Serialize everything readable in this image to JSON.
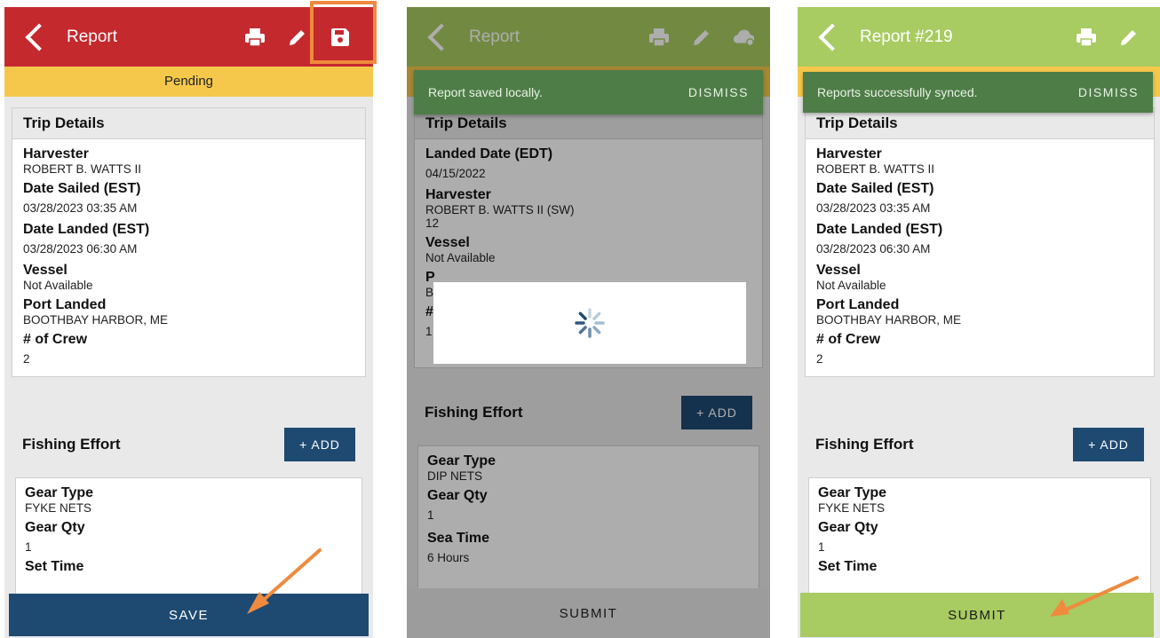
{
  "colors": {
    "saved_header": "#c4292e",
    "synced_header": "#a8cb62",
    "save_button": "#1e4a72",
    "submit_button_light": "#a8cb62",
    "submit_button_grey": "#e6e6e6",
    "pending_bar": "#f5c84c",
    "toast": "#4e7d47",
    "annotation": "#f08a3e"
  },
  "screen1": {
    "header": {
      "title": "Report",
      "icons": [
        "chevron-left-icon",
        "print-icon",
        "pencil-icon",
        "floppy-disk-icon"
      ]
    },
    "status": "Pending",
    "trip": {
      "title": "Trip Details",
      "fields": [
        {
          "label": "Harvester",
          "value": "ROBERT B. WATTS II"
        },
        {
          "label": "Date Sailed (EST)",
          "value": "03/28/2023 03:35 AM"
        },
        {
          "label": "Date Landed (EST)",
          "value": "03/28/2023 06:30 AM"
        },
        {
          "label": "Vessel",
          "value": "Not Available"
        },
        {
          "label": "Port Landed",
          "value": "BOOTHBAY HARBOR, ME"
        },
        {
          "label": "# of Crew",
          "value": "2"
        }
      ]
    },
    "effort": {
      "title": "Fishing Effort",
      "add_label": "+ ADD",
      "fields": [
        {
          "label": "Gear Type",
          "value": "FYKE NETS"
        },
        {
          "label": "Gear Qty",
          "value": "1"
        },
        {
          "label": "Set Time",
          "value": ""
        }
      ]
    },
    "button": "SAVE"
  },
  "screen2": {
    "header": {
      "title": "Report",
      "icons": [
        "chevron-left-icon",
        "print-icon",
        "pencil-icon",
        "cloud-sync-icon"
      ]
    },
    "toast": {
      "message": "Report saved locally.",
      "action": "DISMISS"
    },
    "trip": {
      "title": "Trip Details",
      "fields": [
        {
          "label": "Landed Date (EDT)",
          "value": "04/15/2022"
        },
        {
          "label": "Harvester",
          "value": "ROBERT B. WATTS II (SW)"
        },
        {
          "label": "",
          "value": "12"
        },
        {
          "label": "Vessel",
          "value": "Not Available"
        },
        {
          "label": "P",
          "value": "B"
        },
        {
          "label": "#",
          "value": "1"
        }
      ]
    },
    "effort": {
      "title": "Fishing Effort",
      "add_label": "+ ADD",
      "fields": [
        {
          "label": "Gear Type",
          "value": "DIP NETS"
        },
        {
          "label": "Gear Qty",
          "value": "1"
        },
        {
          "label": "Sea Time",
          "value": "6 Hours"
        }
      ]
    },
    "button": "SUBMIT",
    "loading": "spinner-icon"
  },
  "screen3": {
    "header": {
      "title": "Report #219",
      "icons": [
        "chevron-left-icon",
        "print-icon",
        "pencil-icon"
      ]
    },
    "toast": {
      "message": "Reports successfully synced.",
      "action": "DISMISS"
    },
    "trip": {
      "title": "Trip Details",
      "fields": [
        {
          "label": "Harvester",
          "value": "ROBERT B. WATTS II"
        },
        {
          "label": "Date Sailed (EST)",
          "value": "03/28/2023 03:35 AM"
        },
        {
          "label": "Date Landed (EST)",
          "value": "03/28/2023 06:30 AM"
        },
        {
          "label": "Vessel",
          "value": "Not Available"
        },
        {
          "label": "Port Landed",
          "value": "BOOTHBAY HARBOR, ME"
        },
        {
          "label": "# of Crew",
          "value": "2"
        }
      ]
    },
    "effort": {
      "title": "Fishing Effort",
      "add_label": "+ ADD",
      "fields": [
        {
          "label": "Gear Type",
          "value": "FYKE NETS"
        },
        {
          "label": "Gear Qty",
          "value": "1"
        },
        {
          "label": "Set Time",
          "value": ""
        }
      ]
    },
    "button": "SUBMIT"
  },
  "annotations": [
    "save-icon-highlight",
    "arrow-to-save",
    "arrow-to-submit"
  ]
}
